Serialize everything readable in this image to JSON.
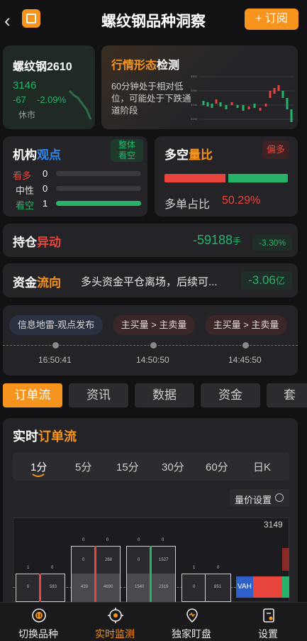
{
  "header": {
    "title": "螺纹钢品种洞察",
    "subscribe_label": "+ 订阅"
  },
  "contract": {
    "name": "螺纹钢2610",
    "price": "3146",
    "change": "-67",
    "change_pct": "-2.09%",
    "status": "休市"
  },
  "pattern": {
    "title_a": "行情形态",
    "title_b": "检测",
    "desc": "60分钟处于相对低位，可能处于下跌通道阶段"
  },
  "institution": {
    "title_a": "机构",
    "title_b": "观点",
    "badge": "整体\n看空",
    "rows": [
      {
        "label": "看多",
        "count": "0",
        "ratio": 0
      },
      {
        "label": "中性",
        "count": "0",
        "ratio": 0
      },
      {
        "label": "看空",
        "count": "1",
        "ratio": 1
      }
    ]
  },
  "longshort": {
    "title_a": "多空",
    "title_b": "量比",
    "badge": "偏多",
    "label": "多单占比",
    "value": "50.29%",
    "long_ratio": 0.5029
  },
  "position": {
    "title_a": "持仓",
    "title_b": "异动",
    "value": "-59188",
    "unit": "手",
    "pct": "-3.30%"
  },
  "fund": {
    "title_a": "资金",
    "title_b": "流向",
    "desc": "多头资金平仓离场，后续可...",
    "value": "-3.06",
    "unit": "亿"
  },
  "timeline": [
    {
      "tag": "信息地雷-观点发布",
      "time": "16:50:41"
    },
    {
      "tag": "主买量 > 主卖量",
      "time": "14:50:50"
    },
    {
      "tag": "主买量 > 主卖量",
      "time": "14:45:50"
    }
  ],
  "tabs": [
    "订单流",
    "资讯",
    "数据",
    "资金",
    "套利"
  ],
  "orderflow": {
    "title_a": "实时",
    "title_b": "订单流",
    "periods": [
      "1分",
      "5分",
      "15分",
      "30分",
      "60分",
      "日K"
    ],
    "active_period": "1分",
    "settings_label": "量价设置",
    "price_level": "3149",
    "vah_label": "VAH",
    "bars": [
      {
        "top": [
          "1",
          "0"
        ],
        "mid": [
          "0",
          "583"
        ]
      },
      {
        "top": [
          "0",
          "0"
        ],
        "upper": [
          "0",
          "268"
        ],
        "mid": [
          "439",
          "4690"
        ]
      },
      {
        "top": [
          "0",
          "0"
        ],
        "upper": [
          "0",
          "1527"
        ],
        "mid": [
          "1540",
          "2319"
        ]
      },
      {
        "top": [
          "1",
          "0"
        ],
        "mid": [
          "0",
          "851"
        ]
      }
    ]
  },
  "nav": [
    {
      "label": "切换品种",
      "icon": "switch-icon"
    },
    {
      "label": "实时监测",
      "icon": "target-icon"
    },
    {
      "label": "独家盯盘",
      "icon": "radar-icon"
    },
    {
      "label": "设置",
      "icon": "settings-icon"
    }
  ],
  "colors": {
    "accent": "#f7941d",
    "up": "#e8453c",
    "down": "#27b46a",
    "blue": "#2f86e8"
  }
}
